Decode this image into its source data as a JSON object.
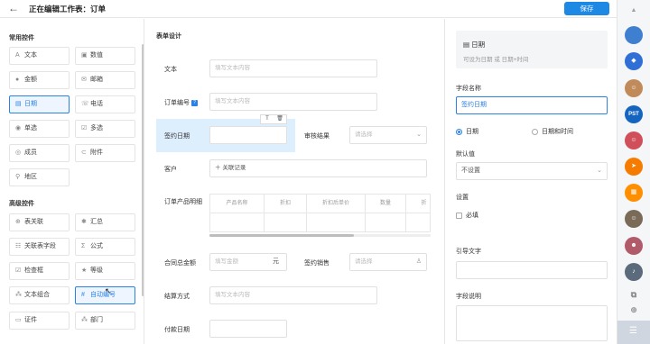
{
  "header": {
    "back_icon": "back-arrow-icon",
    "title": "正在编辑工作表：订单",
    "save_label": "保存"
  },
  "palette": {
    "basic_section": "常用控件",
    "basic": [
      {
        "label": "文本",
        "icon": "A"
      },
      {
        "label": "数值",
        "icon": "▣"
      },
      {
        "label": "金额",
        "icon": "●"
      },
      {
        "label": "邮箱",
        "icon": "✉"
      },
      {
        "label": "日期",
        "icon": "▤"
      },
      {
        "label": "电话",
        "icon": "☏"
      },
      {
        "label": "单选",
        "icon": "◉"
      },
      {
        "label": "多选",
        "icon": "☑"
      },
      {
        "label": "成员",
        "icon": "◎"
      },
      {
        "label": "附件",
        "icon": "⊂"
      },
      {
        "label": "地区",
        "icon": "⚲"
      }
    ],
    "advanced_section": "高级控件",
    "advanced": [
      {
        "label": "表关联",
        "icon": "⊕"
      },
      {
        "label": "汇总",
        "icon": "✱"
      },
      {
        "label": "关联表字段",
        "icon": "☷"
      },
      {
        "label": "公式",
        "icon": "Σ"
      },
      {
        "label": "检查框",
        "icon": "☑"
      },
      {
        "label": "等级",
        "icon": "★"
      },
      {
        "label": "文本组合",
        "icon": "⁂"
      },
      {
        "label": "自动编号",
        "icon": "#"
      },
      {
        "label": "证件",
        "icon": "▭"
      },
      {
        "label": "部门",
        "icon": "⁂"
      }
    ]
  },
  "form": {
    "section_title": "表单设计",
    "fields": {
      "text": {
        "label": "文本",
        "placeholder": "填写文本内容"
      },
      "order_no": {
        "label": "订单编号",
        "placeholder": "填写文本内容"
      },
      "sign_date": {
        "label": "签约日期"
      },
      "review": {
        "label": "审核结果",
        "placeholder": "请选择"
      },
      "customer": {
        "label": "客户",
        "button": "关联记录"
      },
      "details": {
        "label": "订单产品明细",
        "columns": [
          "产品名称",
          "折扣",
          "折扣后单价",
          "数量",
          "折"
        ]
      },
      "total": {
        "label": "合同总金额",
        "placeholder": "填写金额",
        "suffix": "元"
      },
      "sales": {
        "label": "签约销售",
        "placeholder": "请选择"
      },
      "settle": {
        "label": "结算方式",
        "placeholder": "填写文本内容"
      },
      "paydate": {
        "label": "付款日期"
      }
    }
  },
  "props": {
    "type_title": "日期",
    "type_sub": "可设为日期 或 日期+时间",
    "field_name_label": "字段名称",
    "field_name_value": "签约日期",
    "option_date": "日期",
    "option_datetime": "日期和时间",
    "default_label": "默认值",
    "default_value": "不设置",
    "settings_label": "设置",
    "required_label": "必填",
    "guide_label": "引导文字",
    "desc_label": "字段说明"
  },
  "sidebar": {
    "icons": [
      {
        "name": "notification-icon",
        "glyph": "▲",
        "color": "#9aa0a6"
      },
      {
        "name": "avatar-1",
        "glyph": "",
        "color": "#3f7fd0"
      },
      {
        "name": "app-icon-blue",
        "glyph": "◆",
        "color": "#2f6fd6"
      },
      {
        "name": "group-avatar-1",
        "glyph": "☺",
        "color": "#c08a5a"
      },
      {
        "name": "pst-icon",
        "glyph": "PST",
        "color": "#1565c0"
      },
      {
        "name": "group-avatar-2",
        "glyph": "☺",
        "color": "#d04f5a"
      },
      {
        "name": "send-icon",
        "glyph": "➤",
        "color": "#f57c00"
      },
      {
        "name": "apps-grid-icon",
        "glyph": "▦",
        "color": "#ff8f00"
      },
      {
        "name": "group-avatar-3",
        "glyph": "☺",
        "color": "#7a6a58"
      },
      {
        "name": "avatar-2",
        "glyph": "☻",
        "color": "#b05a6a"
      },
      {
        "name": "bell-icon",
        "glyph": "♪",
        "color": "#5b6b7b"
      }
    ],
    "tools": [
      {
        "name": "copy-icon",
        "glyph": "⧉"
      },
      {
        "name": "add-icon",
        "glyph": "⊕"
      }
    ]
  }
}
